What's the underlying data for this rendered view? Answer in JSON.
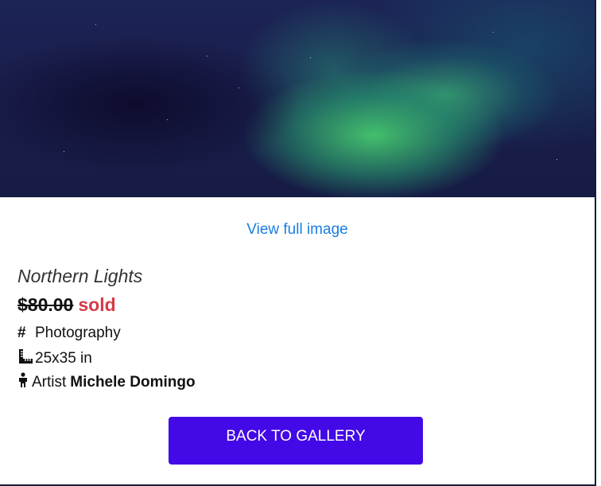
{
  "image": {
    "alt_icon": "aurora-photo",
    "view_full_label": "View full image"
  },
  "artwork": {
    "title": "Northern Lights",
    "price": "$80.00",
    "status": "sold",
    "category": "Photography",
    "size": "25x35 in",
    "artist_label": "Artist",
    "artist_name": "Michele Domingo"
  },
  "actions": {
    "back_label": "BACK TO GALLERY"
  },
  "colors": {
    "link": "#1a7ee6",
    "sold": "#d63a47",
    "button": "#4309e6"
  },
  "icons": {
    "category": "hashtag-icon",
    "size": "ruler-icon",
    "artist": "person-icon"
  }
}
